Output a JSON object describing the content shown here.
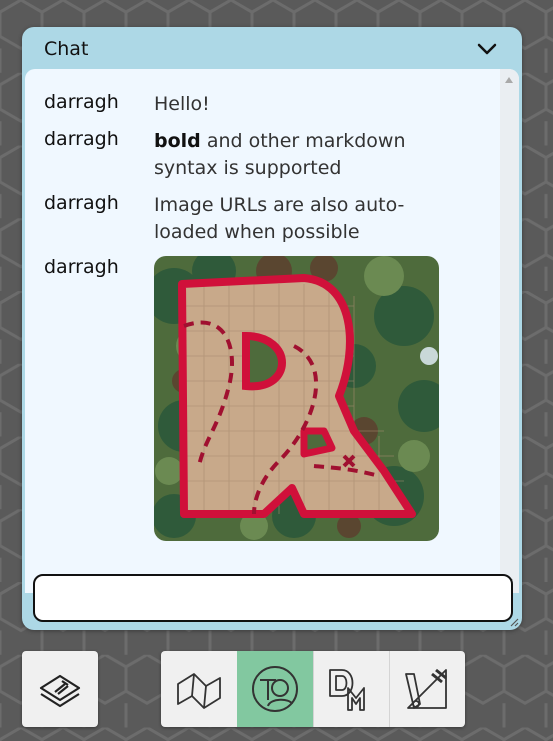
{
  "chat": {
    "title": "Chat",
    "messages": [
      {
        "author": "darragh",
        "text": "Hello!"
      },
      {
        "author": "darragh",
        "bold": "bold",
        "text": " and other markdown syntax is supported"
      },
      {
        "author": "darragh",
        "text": "Image URLs are also auto-loaded when possible"
      },
      {
        "author": "darragh",
        "image": "dungeon-map-image"
      }
    ],
    "input_placeholder": ""
  },
  "toolbar": {
    "left": {
      "icon": "layers-icon"
    },
    "tools": [
      {
        "icon": "map-fold-icon",
        "active": false
      },
      {
        "icon": "token-user-icon",
        "active": true
      },
      {
        "icon": "dm-icon",
        "active": false
      },
      {
        "icon": "draw-ruler-icon",
        "active": false
      }
    ]
  },
  "colors": {
    "panel": "#add8e6",
    "chat_bg": "#f0f8ff",
    "active_tool": "#82c8a0",
    "background": "#5a5a5a",
    "map_outline": "#d0103a"
  }
}
